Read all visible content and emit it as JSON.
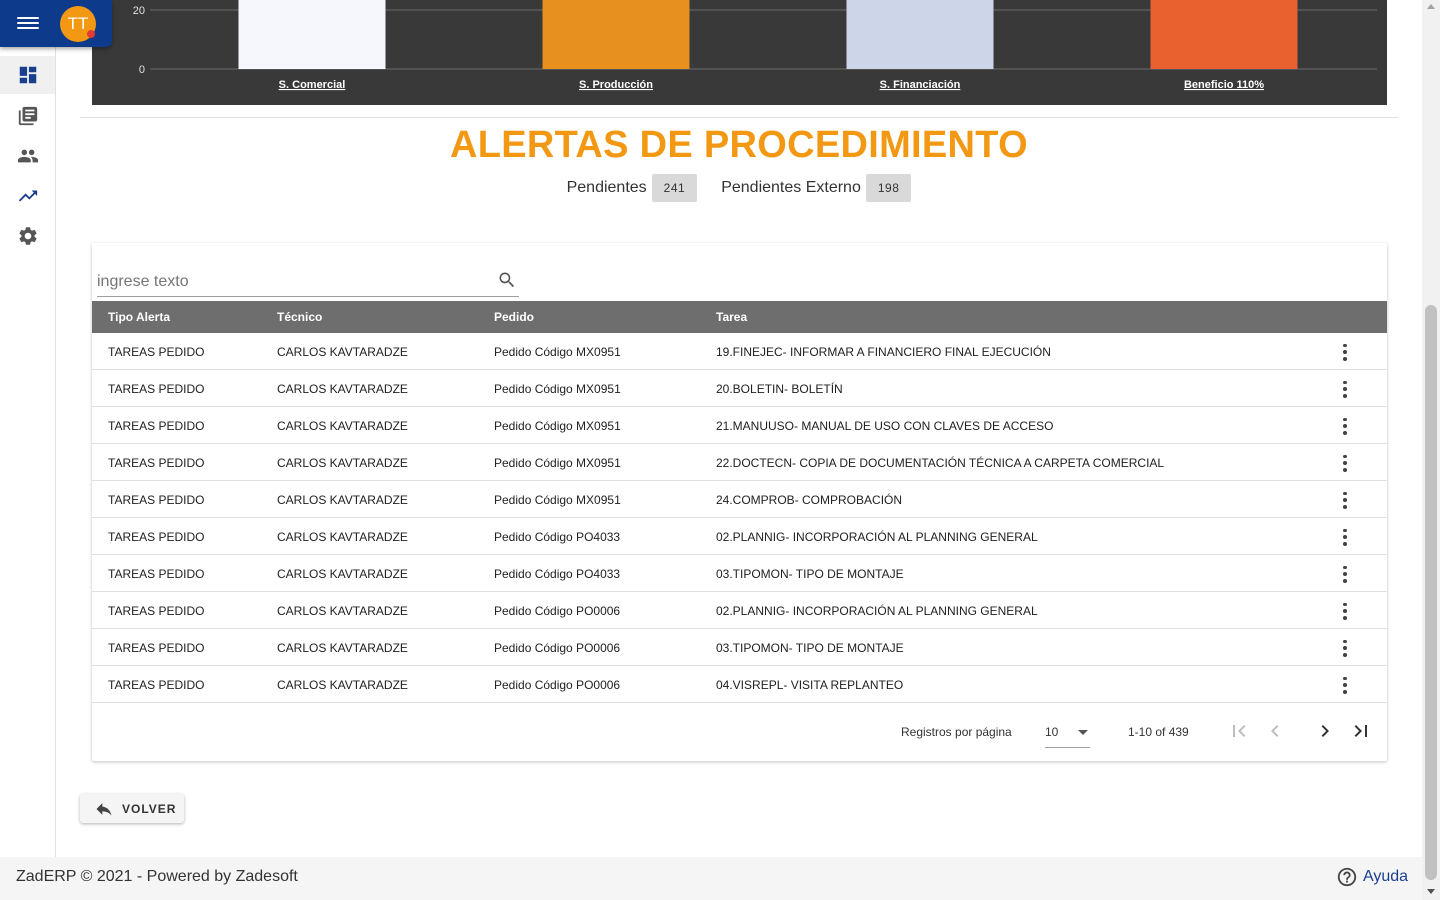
{
  "header": {
    "avatar_initials": "TT",
    "menu_icon": "menu-icon"
  },
  "sidebar": {
    "items": [
      {
        "icon": "dashboard-icon",
        "active": true
      },
      {
        "icon": "library-books-icon",
        "active": false
      },
      {
        "icon": "people-icon",
        "active": false
      },
      {
        "icon": "trending-up-icon",
        "active": false
      },
      {
        "icon": "settings-gear-icon",
        "active": false
      }
    ]
  },
  "chart_data": {
    "type": "bar",
    "categories": [
      "S. Comercial",
      "S. Producción",
      "S. Financiación",
      "Beneficio 110%"
    ],
    "values": [
      25,
      25,
      25,
      25
    ],
    "colors": [
      "#f5f7fc",
      "#e8901f",
      "#cdd6e8",
      "#e8612f"
    ],
    "y_tick_labels": [
      "0",
      "20"
    ],
    "background": "#393939"
  },
  "section": {
    "title": "ALERTAS DE PROCEDIMIENTO",
    "pending_label": "Pendientes",
    "pending_count": "241",
    "pending_external_label": "Pendientes Externo",
    "pending_external_count": "198"
  },
  "search": {
    "placeholder": "ingrese texto",
    "value": ""
  },
  "table": {
    "columns": [
      "Tipo Alerta",
      "Técnico",
      "Pedido",
      "Tarea"
    ],
    "rows": [
      [
        "TAREAS PEDIDO",
        "CARLOS KAVTARADZE",
        "Pedido Código MX0951",
        "19.FINEJEC- INFORMAR A FINANCIERO FINAL EJECUCIÓN"
      ],
      [
        "TAREAS PEDIDO",
        "CARLOS KAVTARADZE",
        "Pedido Código MX0951",
        "20.BOLETIN- BOLETÍN"
      ],
      [
        "TAREAS PEDIDO",
        "CARLOS KAVTARADZE",
        "Pedido Código MX0951",
        "21.MANUUSO- MANUAL DE USO CON CLAVES DE ACCESO"
      ],
      [
        "TAREAS PEDIDO",
        "CARLOS KAVTARADZE",
        "Pedido Código MX0951",
        "22.DOCTECN- COPIA DE DOCUMENTACIÓN TÉCNICA A CARPETA COMERCIAL"
      ],
      [
        "TAREAS PEDIDO",
        "CARLOS KAVTARADZE",
        "Pedido Código MX0951",
        "24.COMPROB- COMPROBACIÓN"
      ],
      [
        "TAREAS PEDIDO",
        "CARLOS KAVTARADZE",
        "Pedido Código PO4033",
        "02.PLANNIG- INCORPORACIÓN AL PLANNING GENERAL"
      ],
      [
        "TAREAS PEDIDO",
        "CARLOS KAVTARADZE",
        "Pedido Código PO4033",
        "03.TIPOMON- TIPO DE MONTAJE"
      ],
      [
        "TAREAS PEDIDO",
        "CARLOS KAVTARADZE",
        "Pedido Código PO0006",
        "02.PLANNIG- INCORPORACIÓN AL PLANNING GENERAL"
      ],
      [
        "TAREAS PEDIDO",
        "CARLOS KAVTARADZE",
        "Pedido Código PO0006",
        "03.TIPOMON- TIPO DE MONTAJE"
      ],
      [
        "TAREAS PEDIDO",
        "CARLOS KAVTARADZE",
        "Pedido Código PO0006",
        "04.VISREPL- VISITA REPLANTEO"
      ]
    ]
  },
  "paginator": {
    "label": "Registros por página",
    "page_size": "10",
    "range": "1-10 of 439"
  },
  "actions": {
    "back_label": "VOLVER"
  },
  "footer": {
    "text": "ZadERP © 2021 - Powered by Zadesoft",
    "help_label": "Ayuda"
  },
  "colors": {
    "brand_blue": "#0d3a8a",
    "accent_orange": "#f39812",
    "table_header": "#6e6e6e"
  }
}
